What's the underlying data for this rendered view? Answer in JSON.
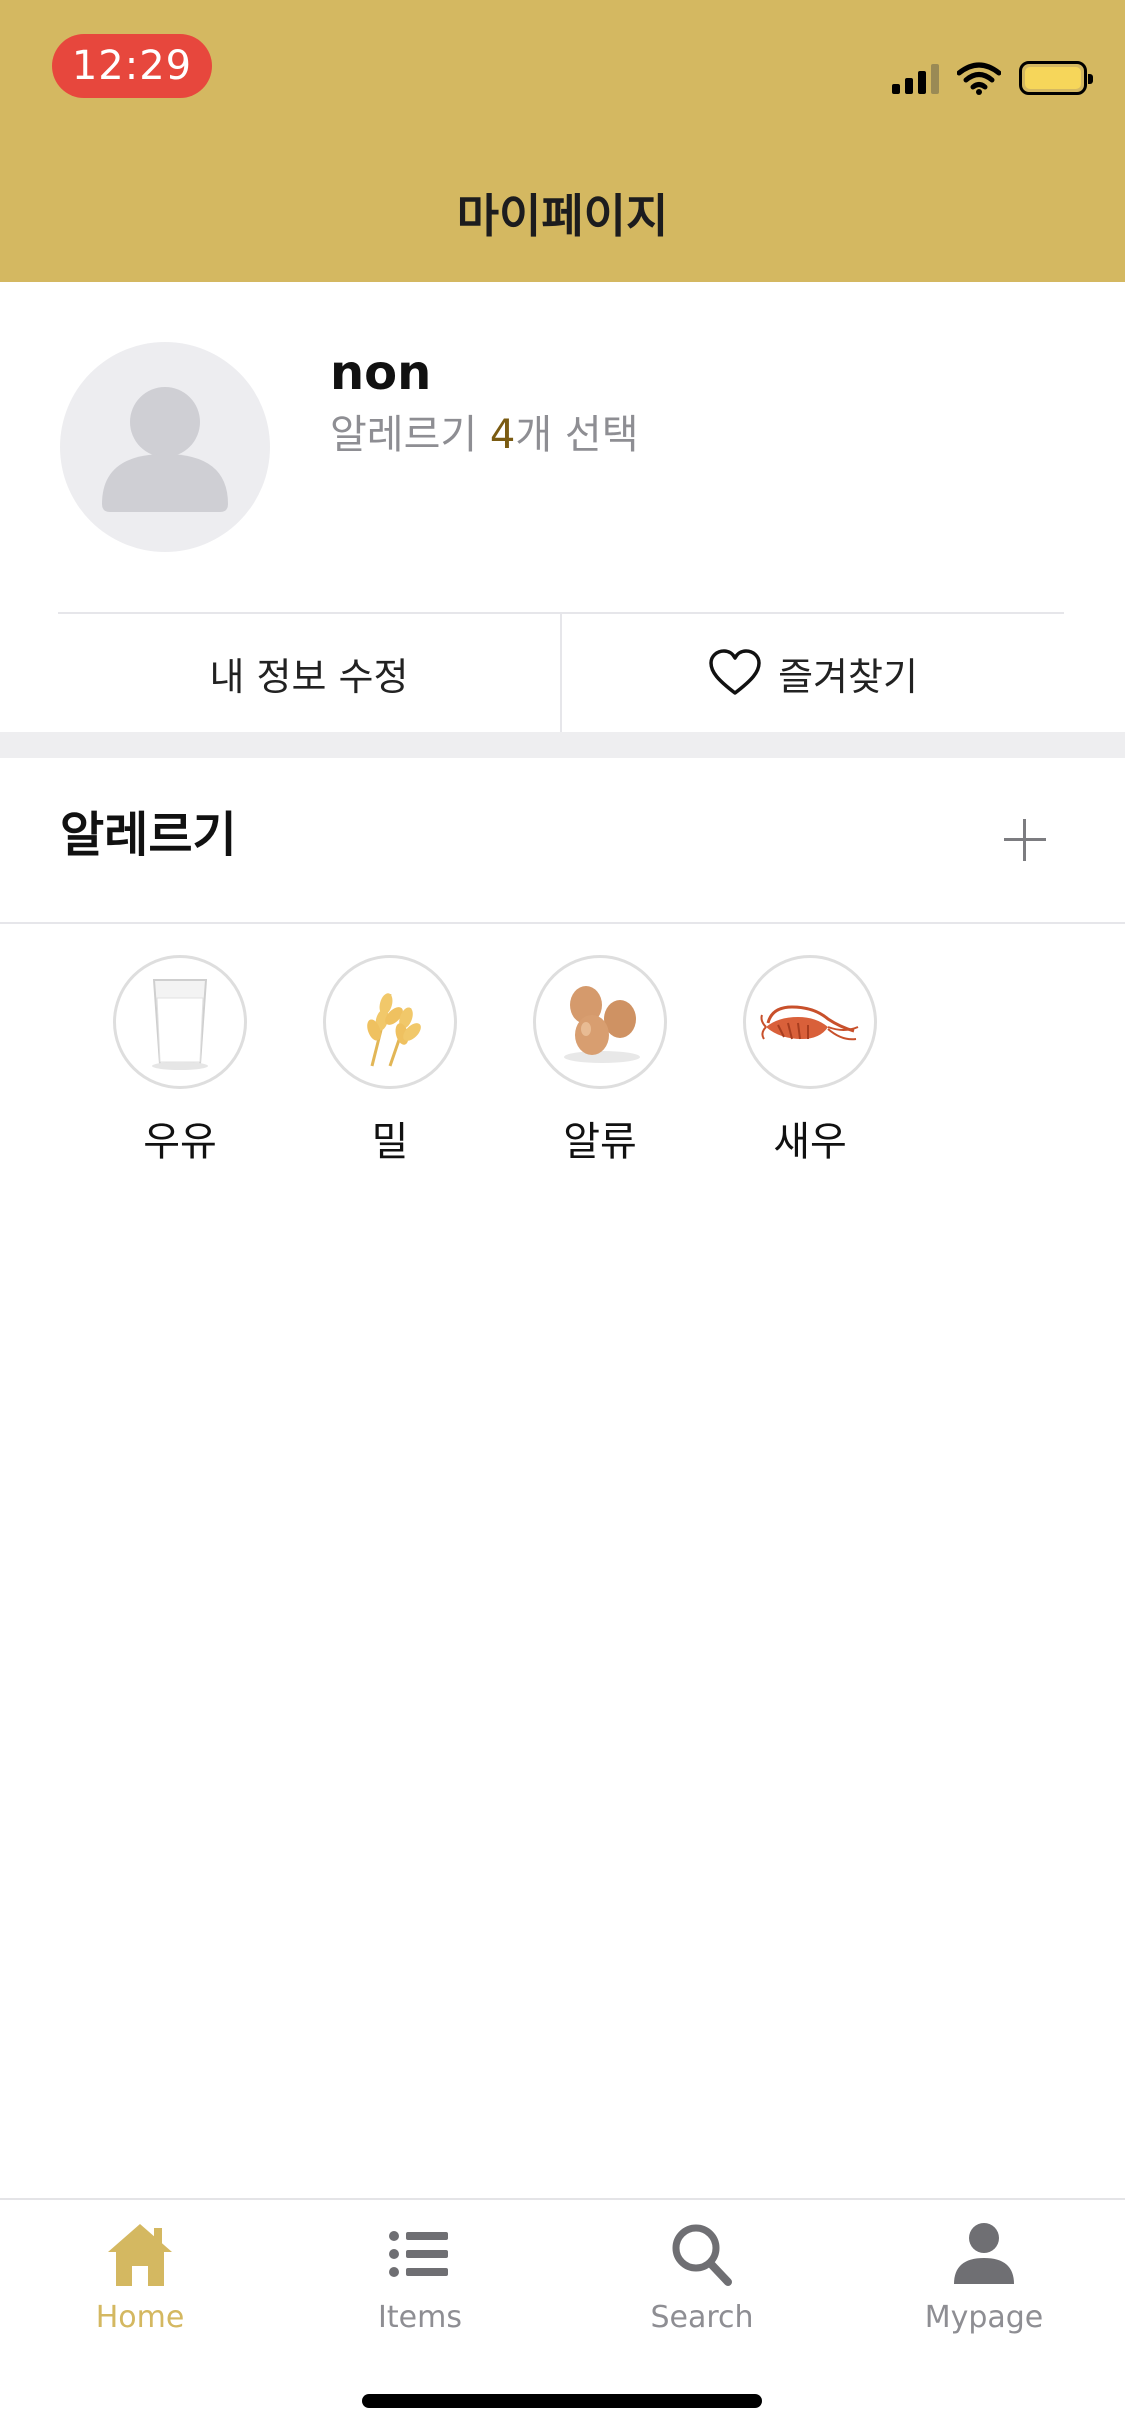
{
  "status_bar": {
    "time": "12:29"
  },
  "header": {
    "title": "마이페이지"
  },
  "profile": {
    "username": "non",
    "allergy_prefix": "알레르기 ",
    "allergy_count": "4",
    "allergy_suffix": "개 선택"
  },
  "actions": {
    "edit_label": "내 정보 수정",
    "favorites_label": "즐겨찾기"
  },
  "allergy_section": {
    "title": "알레르기",
    "items": [
      {
        "label": "우유",
        "icon": "milk-glass-icon"
      },
      {
        "label": "밀",
        "icon": "wheat-icon"
      },
      {
        "label": "알류",
        "icon": "eggs-icon"
      },
      {
        "label": "새우",
        "icon": "shrimp-icon"
      }
    ]
  },
  "tabbar": {
    "tabs": [
      {
        "label": "Home",
        "icon": "home-icon",
        "active": true
      },
      {
        "label": "Items",
        "icon": "list-icon",
        "active": false
      },
      {
        "label": "Search",
        "icon": "search-icon",
        "active": false
      },
      {
        "label": "Mypage",
        "icon": "person-icon",
        "active": false
      }
    ]
  },
  "colors": {
    "header_bg": "#d4b861",
    "accent": "#d4b861",
    "time_pill": "#e7473d",
    "count_highlight": "#7a5b12"
  }
}
